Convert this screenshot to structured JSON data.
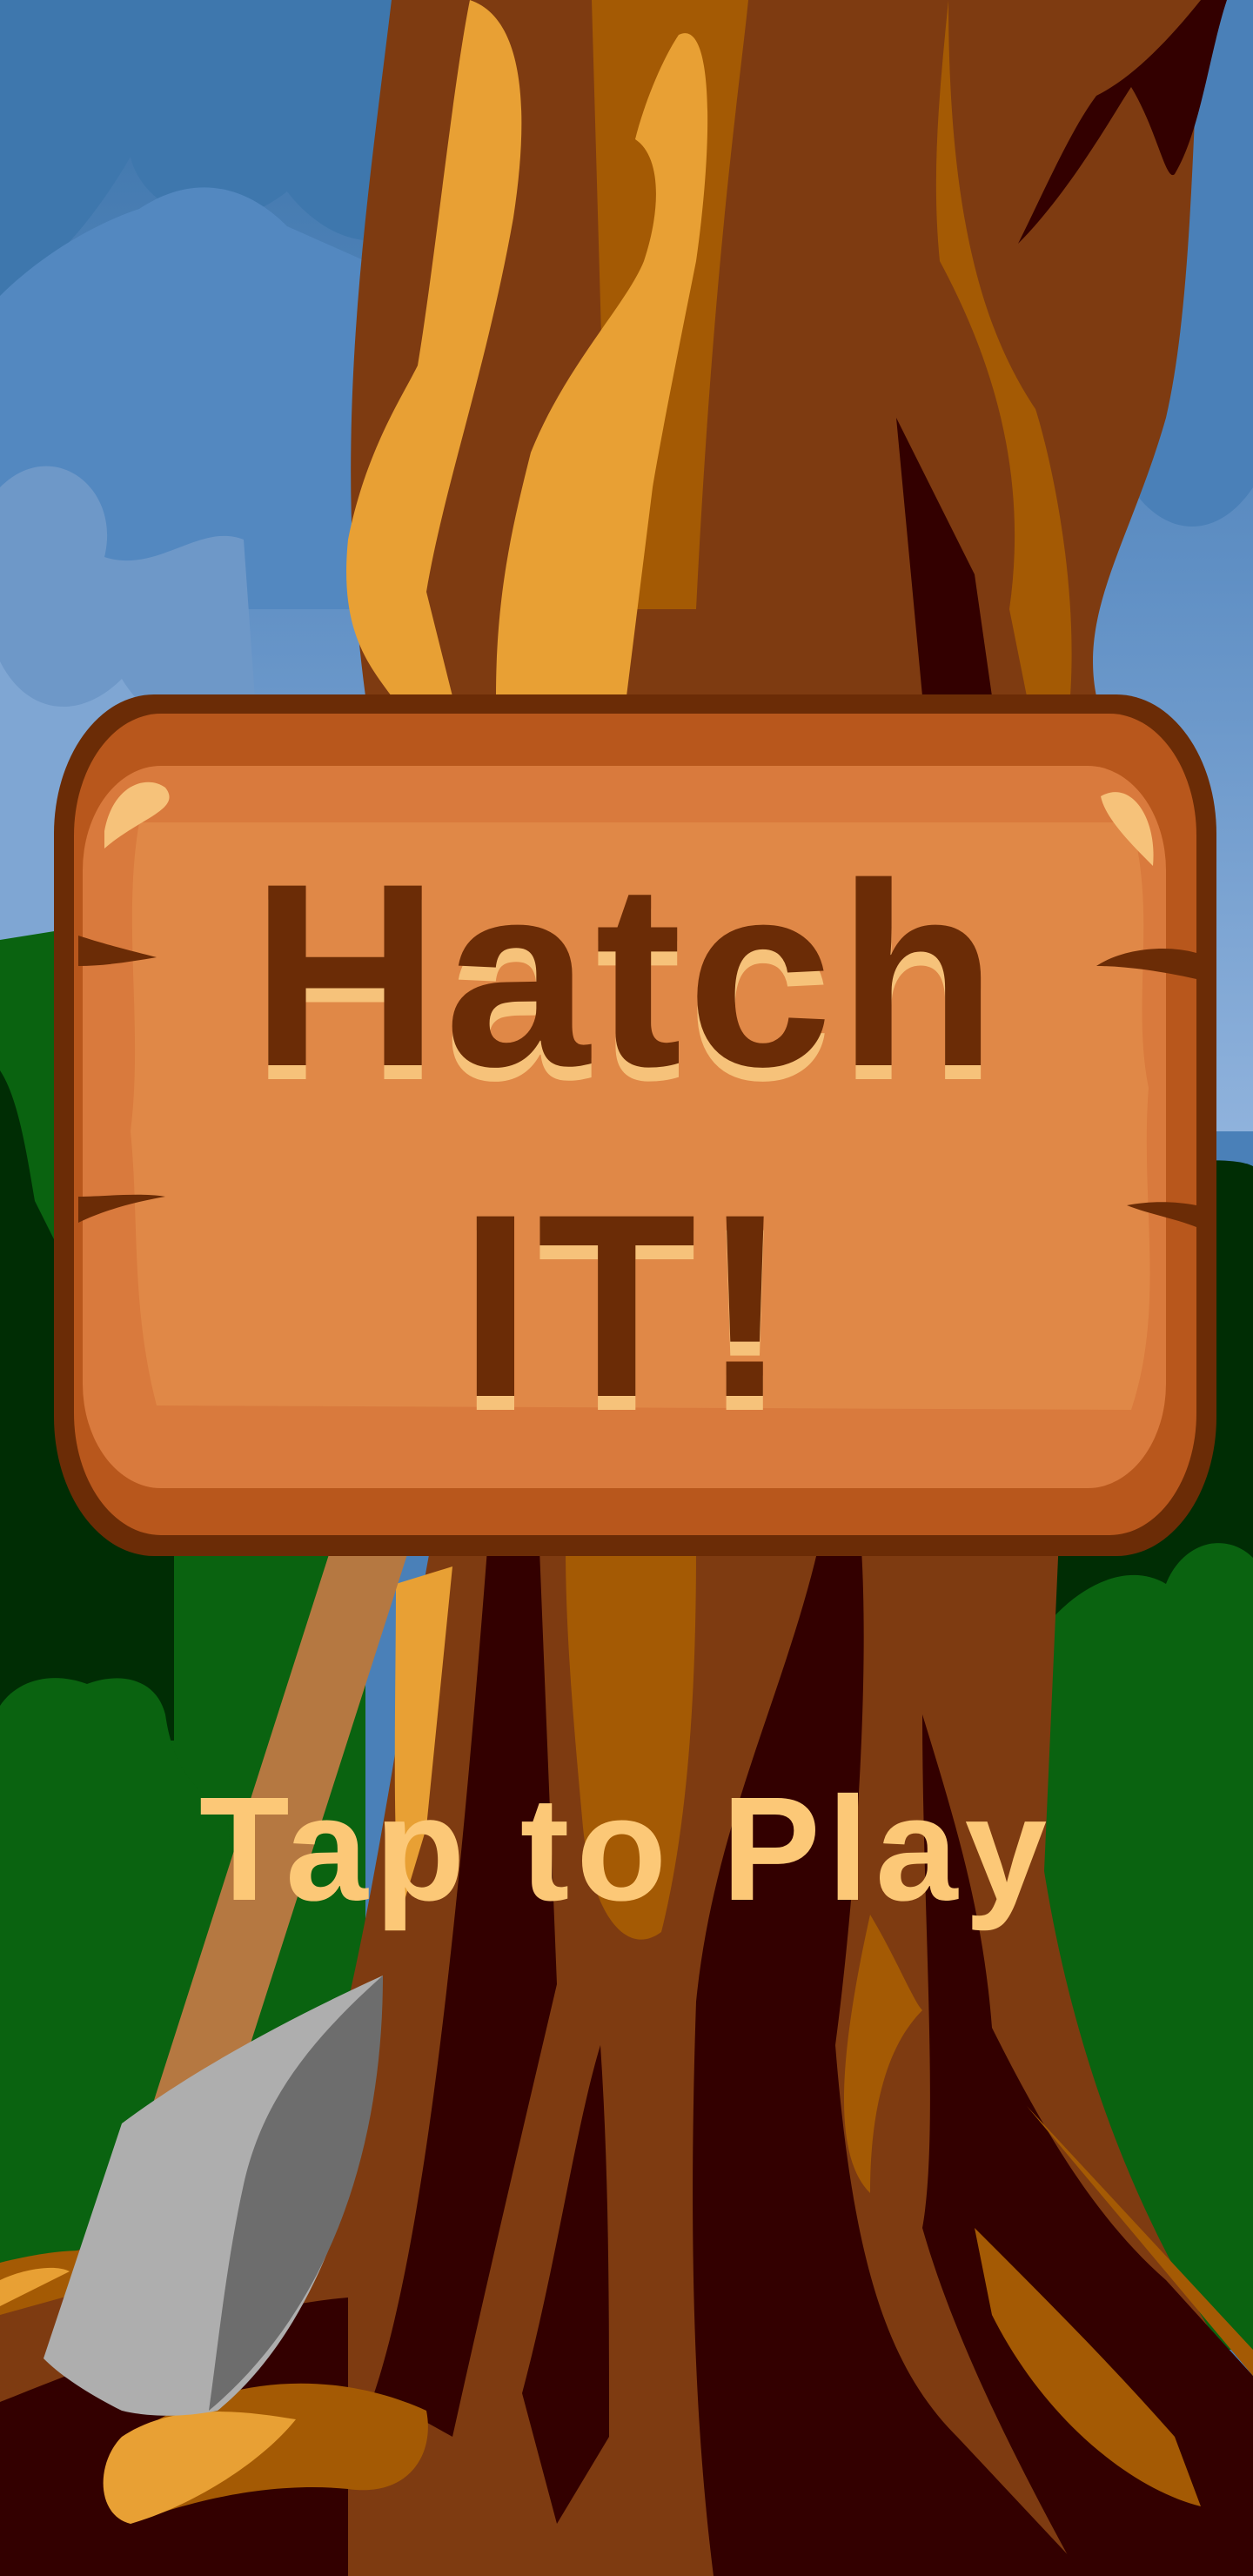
{
  "game": {
    "title_line1": "Hatch",
    "title_line2": "IT!",
    "tap_prompt": "Tap to Play"
  },
  "colors": {
    "sky": "#4a80b8",
    "tree_trunk": "#7e3b11",
    "tree_highlight": "#e8a034",
    "sign_face": "#e08847",
    "sign_border": "#6b2c06",
    "title_text": "#6b2c06",
    "prompt_text": "#fcc877",
    "bush": "#0a6310",
    "axe_blade": "#aeaeae"
  },
  "icons": [
    "cloud-icon",
    "tree-icon",
    "wooden-sign-icon",
    "axe-icon",
    "bush-icon"
  ]
}
